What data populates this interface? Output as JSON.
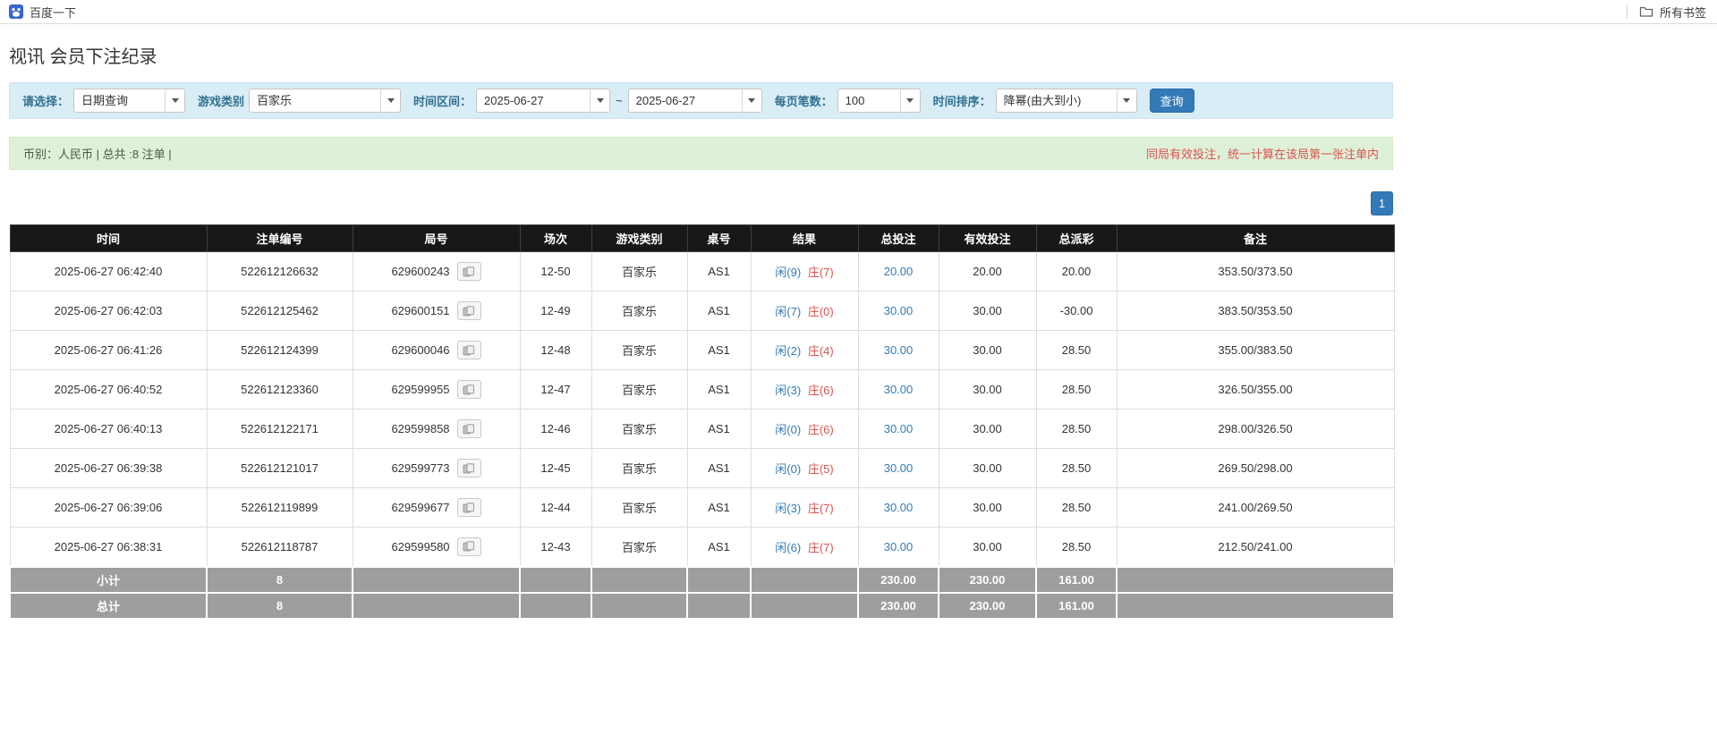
{
  "colors": {
    "accent_blue": "#337ab7",
    "filter_bar_bg": "#d9edf7",
    "filter_label_blue": "#31708f",
    "summary_bar_bg": "#dff0d8",
    "notice_red": "#d9534f",
    "table_header_bg": "#181818",
    "summary_row_bg": "#9e9e9e",
    "player_blue": "#337ab7",
    "banker_red": "#d9534f"
  },
  "bookmarks_bar": {
    "bookmark_label": "百度一下",
    "all_bookmarks_label": "所有书签"
  },
  "page_title": "视讯 会员下注纪录",
  "filters": {
    "select_label": "请选择：",
    "select_value": "日期查询",
    "game_type_label": "游戏类别",
    "game_type_value": "百家乐",
    "date_range_label": "时间区间：",
    "date_from": "2025-06-27",
    "date_separator": "~",
    "date_to": "2025-06-27",
    "page_size_label": "每页笔数：",
    "page_size_value": "100",
    "sort_label": "时间排序：",
    "sort_value": "降幂(由大到小)",
    "search_button_label": "查询"
  },
  "summary_bar": {
    "info_text": "币别：人民币 | 总共 :8 注单 |",
    "notice_text": "同局有效投注，统一计算在该局第一张注单内"
  },
  "pagination": {
    "current_page": "1"
  },
  "table": {
    "headers": [
      "时间",
      "注单编号",
      "局号",
      "场次",
      "游戏类别",
      "桌号",
      "结果",
      "总投注",
      "有效投注",
      "总派彩",
      "备注"
    ],
    "rows": [
      {
        "time": "2025-06-27 06:42:40",
        "bet_no": "522612126632",
        "round_no": "629600243",
        "session": "12-50",
        "game_type": "百家乐",
        "table_no": "AS1",
        "result_player": "闲(9)",
        "result_banker": "庄(7)",
        "total_bet": "20.00",
        "valid_bet": "20.00",
        "payout": "20.00",
        "remark": "353.50/373.50"
      },
      {
        "time": "2025-06-27 06:42:03",
        "bet_no": "522612125462",
        "round_no": "629600151",
        "session": "12-49",
        "game_type": "百家乐",
        "table_no": "AS1",
        "result_player": "闲(7)",
        "result_banker": "庄(0)",
        "total_bet": "30.00",
        "valid_bet": "30.00",
        "payout": "-30.00",
        "remark": "383.50/353.50"
      },
      {
        "time": "2025-06-27 06:41:26",
        "bet_no": "522612124399",
        "round_no": "629600046",
        "session": "12-48",
        "game_type": "百家乐",
        "table_no": "AS1",
        "result_player": "闲(2)",
        "result_banker": "庄(4)",
        "total_bet": "30.00",
        "valid_bet": "30.00",
        "payout": "28.50",
        "remark": "355.00/383.50"
      },
      {
        "time": "2025-06-27 06:40:52",
        "bet_no": "522612123360",
        "round_no": "629599955",
        "session": "12-47",
        "game_type": "百家乐",
        "table_no": "AS1",
        "result_player": "闲(3)",
        "result_banker": "庄(6)",
        "total_bet": "30.00",
        "valid_bet": "30.00",
        "payout": "28.50",
        "remark": "326.50/355.00"
      },
      {
        "time": "2025-06-27 06:40:13",
        "bet_no": "522612122171",
        "round_no": "629599858",
        "session": "12-46",
        "game_type": "百家乐",
        "table_no": "AS1",
        "result_player": "闲(0)",
        "result_banker": "庄(6)",
        "total_bet": "30.00",
        "valid_bet": "30.00",
        "payout": "28.50",
        "remark": "298.00/326.50"
      },
      {
        "time": "2025-06-27 06:39:38",
        "bet_no": "522612121017",
        "round_no": "629599773",
        "session": "12-45",
        "game_type": "百家乐",
        "table_no": "AS1",
        "result_player": "闲(0)",
        "result_banker": "庄(5)",
        "total_bet": "30.00",
        "valid_bet": "30.00",
        "payout": "28.50",
        "remark": "269.50/298.00"
      },
      {
        "time": "2025-06-27 06:39:06",
        "bet_no": "522612119899",
        "round_no": "629599677",
        "session": "12-44",
        "game_type": "百家乐",
        "table_no": "AS1",
        "result_player": "闲(3)",
        "result_banker": "庄(7)",
        "total_bet": "30.00",
        "valid_bet": "30.00",
        "payout": "28.50",
        "remark": "241.00/269.50"
      },
      {
        "time": "2025-06-27 06:38:31",
        "bet_no": "522612118787",
        "round_no": "629599580",
        "session": "12-43",
        "game_type": "百家乐",
        "table_no": "AS1",
        "result_player": "闲(6)",
        "result_banker": "庄(7)",
        "total_bet": "30.00",
        "valid_bet": "30.00",
        "payout": "28.50",
        "remark": "212.50/241.00"
      }
    ],
    "subtotal_row": {
      "label": "小计",
      "count": "8",
      "total_bet": "230.00",
      "valid_bet": "230.00",
      "total_payout": "161.00"
    },
    "total_row": {
      "label": "总计",
      "count": "8",
      "total_bet": "230.00",
      "valid_bet": "230.00",
      "total_payout": "161.00"
    }
  }
}
